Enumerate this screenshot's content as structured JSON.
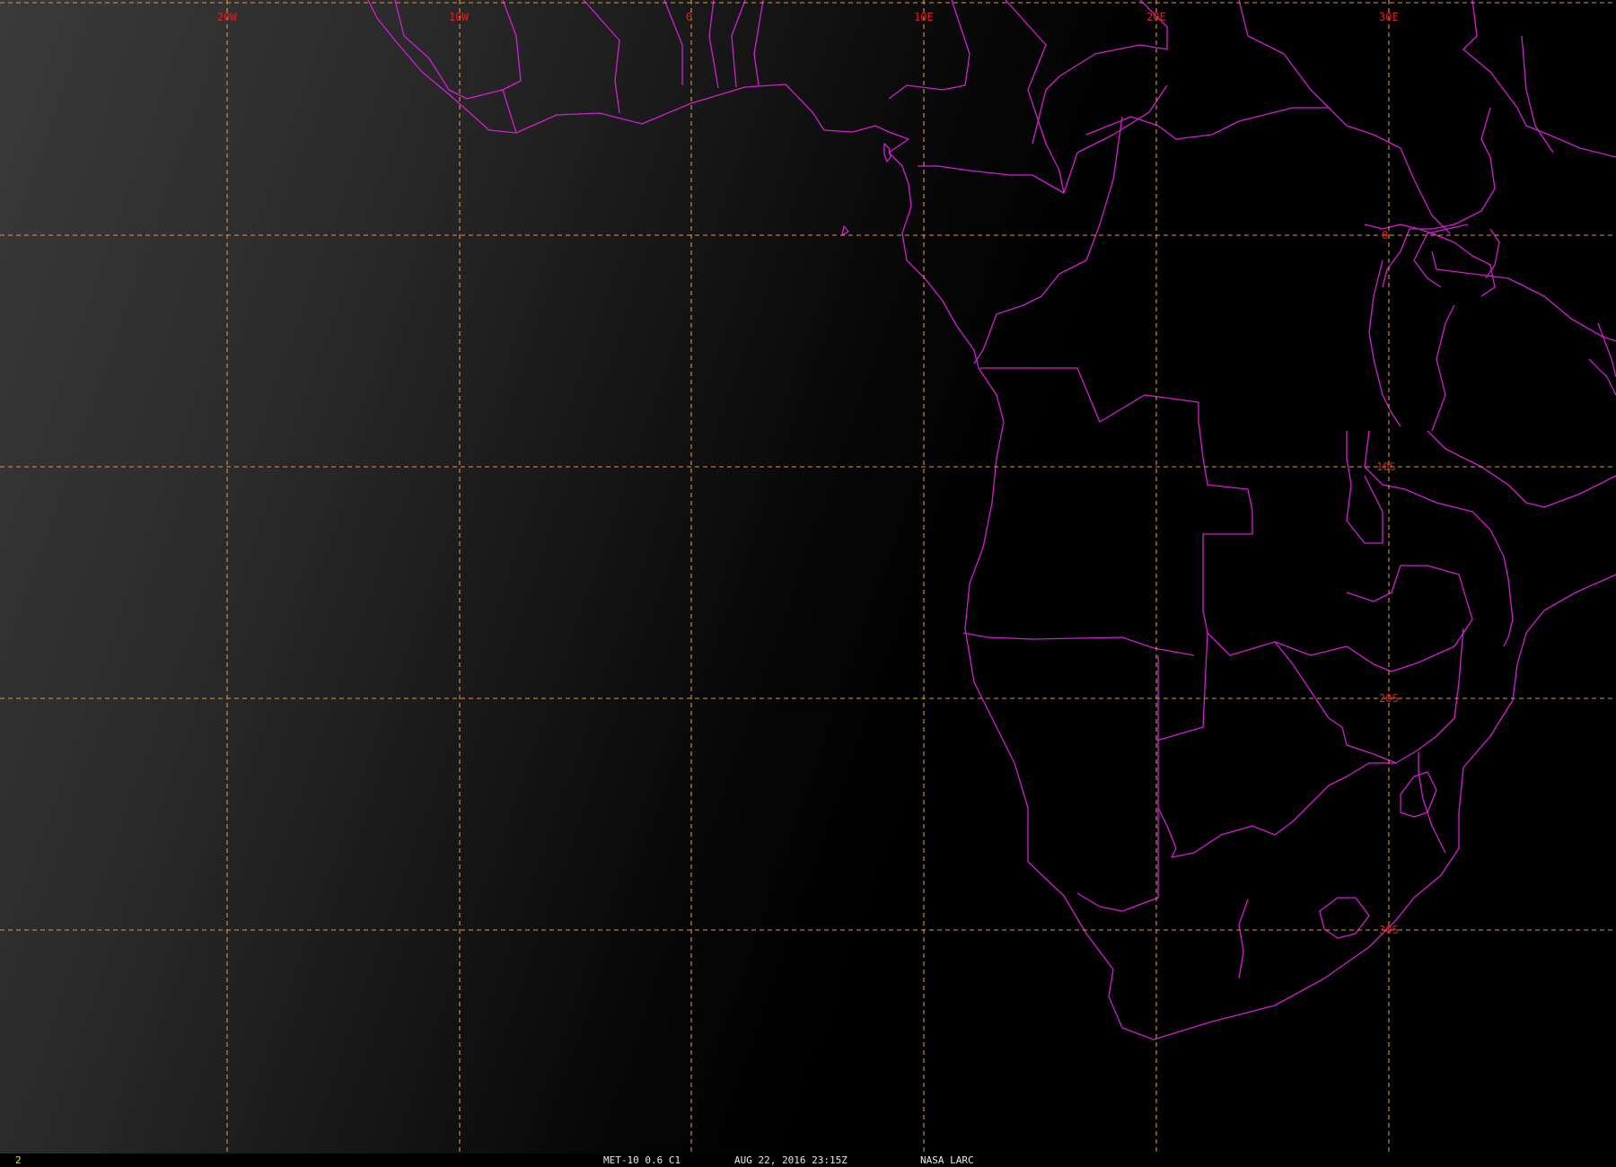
{
  "image": {
    "satellite_product": "MET-10 0.6 C1",
    "datetime": "AUG 22, 2016 23:15Z",
    "organization": "NASA LARC",
    "frame_number": "2"
  },
  "grid": {
    "longitude_labels": [
      "20W",
      "10W",
      "0",
      "10E",
      "20E",
      "30E"
    ],
    "latitude_labels": [
      "0",
      "10S",
      "20S",
      "30S"
    ]
  },
  "colors": {
    "background": "#000000",
    "ocean_glint": "#3a3a3a",
    "boundaries": "#d21ed2",
    "gridlines": "#d9964a",
    "grid_labels": "#e11e1e",
    "frame_number": "#e6e600",
    "status_text": "#e8e8e8"
  }
}
